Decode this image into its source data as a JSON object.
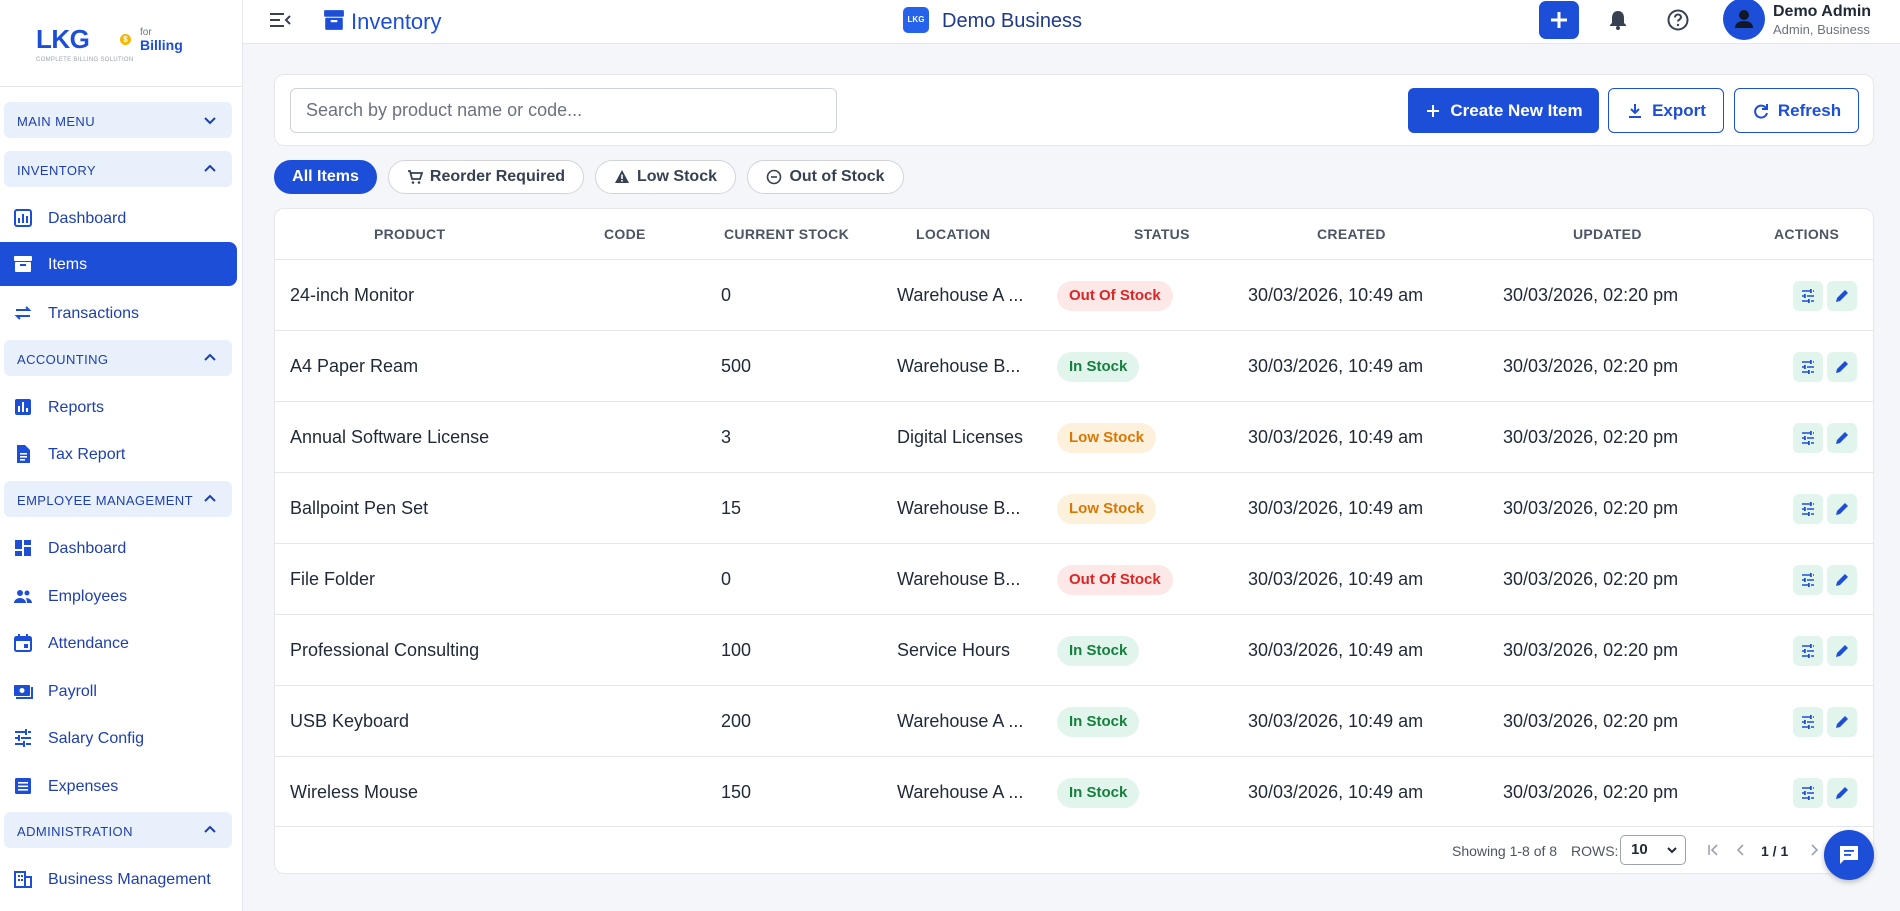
{
  "brand": {
    "logo_text": "LKG",
    "for_text": "for",
    "billing_text": "Billing",
    "tagline": "COMPLETE BILLING SOLUTION",
    "primary_color": "#1d4ed8"
  },
  "sidebar": {
    "sections": [
      {
        "label": "MAIN MENU",
        "expanded": false
      },
      {
        "label": "INVENTORY",
        "expanded": true
      },
      {
        "label": "ACCOUNTING",
        "expanded": true
      },
      {
        "label": "EMPLOYEE MANAGEMENT",
        "expanded": true
      },
      {
        "label": "ADMINISTRATION",
        "expanded": true
      }
    ],
    "items": [
      {
        "label": "Dashboard",
        "icon": "bar-chart-icon",
        "active": false
      },
      {
        "label": "Items",
        "icon": "archive-icon",
        "active": true
      },
      {
        "label": "Transactions",
        "icon": "swap-icon",
        "active": false
      },
      {
        "label": "Reports",
        "icon": "report-chart-icon",
        "active": false
      },
      {
        "label": "Tax Report",
        "icon": "document-icon",
        "active": false
      },
      {
        "label": "Dashboard",
        "icon": "dashboard-grid-icon",
        "active": false
      },
      {
        "label": "Employees",
        "icon": "people-icon",
        "active": false
      },
      {
        "label": "Attendance",
        "icon": "calendar-icon",
        "active": false
      },
      {
        "label": "Payroll",
        "icon": "money-icon",
        "active": false
      },
      {
        "label": "Salary Config",
        "icon": "tune-icon",
        "active": false
      },
      {
        "label": "Expenses",
        "icon": "list-icon",
        "active": false
      },
      {
        "label": "Business Management",
        "icon": "building-icon",
        "active": false
      }
    ]
  },
  "topbar": {
    "page_title": "Inventory",
    "business_icon_text": "LKG",
    "business_name": "Demo Business",
    "user_name": "Demo Admin",
    "user_role": "Admin, Business"
  },
  "toolbar": {
    "search_placeholder": "Search by product name or code...",
    "search_value": "",
    "create_label": "Create New Item",
    "export_label": "Export",
    "refresh_label": "Refresh"
  },
  "filters": [
    {
      "label": "All Items",
      "active": true
    },
    {
      "label": "Reorder Required",
      "active": false
    },
    {
      "label": "Low Stock",
      "active": false
    },
    {
      "label": "Out of Stock",
      "active": false
    }
  ],
  "table": {
    "headers": [
      "PRODUCT",
      "CODE",
      "CURRENT STOCK",
      "LOCATION",
      "STATUS",
      "CREATED",
      "UPDATED",
      "ACTIONS"
    ],
    "rows": [
      {
        "product": "24-inch Monitor",
        "code": "",
        "stock": "0",
        "location": "Warehouse A ...",
        "status": "Out Of Stock",
        "created": "30/03/2026, 10:49 am",
        "updated": "30/03/2026, 02:20 pm"
      },
      {
        "product": "A4 Paper Ream",
        "code": "",
        "stock": "500",
        "location": "Warehouse B...",
        "status": "In Stock",
        "created": "30/03/2026, 10:49 am",
        "updated": "30/03/2026, 02:20 pm"
      },
      {
        "product": "Annual Software License",
        "code": "",
        "stock": "3",
        "location": "Digital Licenses",
        "status": "Low Stock",
        "created": "30/03/2026, 10:49 am",
        "updated": "30/03/2026, 02:20 pm"
      },
      {
        "product": "Ballpoint Pen Set",
        "code": "",
        "stock": "15",
        "location": "Warehouse B...",
        "status": "Low Stock",
        "created": "30/03/2026, 10:49 am",
        "updated": "30/03/2026, 02:20 pm"
      },
      {
        "product": "File Folder",
        "code": "",
        "stock": "0",
        "location": "Warehouse B...",
        "status": "Out Of Stock",
        "created": "30/03/2026, 10:49 am",
        "updated": "30/03/2026, 02:20 pm"
      },
      {
        "product": "Professional Consulting",
        "code": "",
        "stock": "100",
        "location": "Service Hours",
        "status": "In Stock",
        "created": "30/03/2026, 10:49 am",
        "updated": "30/03/2026, 02:20 pm"
      },
      {
        "product": "USB Keyboard",
        "code": "",
        "stock": "200",
        "location": "Warehouse A ...",
        "status": "In Stock",
        "created": "30/03/2026, 10:49 am",
        "updated": "30/03/2026, 02:20 pm"
      },
      {
        "product": "Wireless Mouse",
        "code": "",
        "stock": "150",
        "location": "Warehouse A ...",
        "status": "In Stock",
        "created": "30/03/2026, 10:49 am",
        "updated": "30/03/2026, 02:20 pm"
      }
    ]
  },
  "pagination": {
    "showing": "Showing 1-8 of 8",
    "rows_label": "ROWS:",
    "rows_value": "10",
    "page": "1 / 1"
  },
  "status_colors": {
    "out_of_stock": "#dc2626",
    "in_stock": "#15803d",
    "low_stock": "#d97706"
  }
}
